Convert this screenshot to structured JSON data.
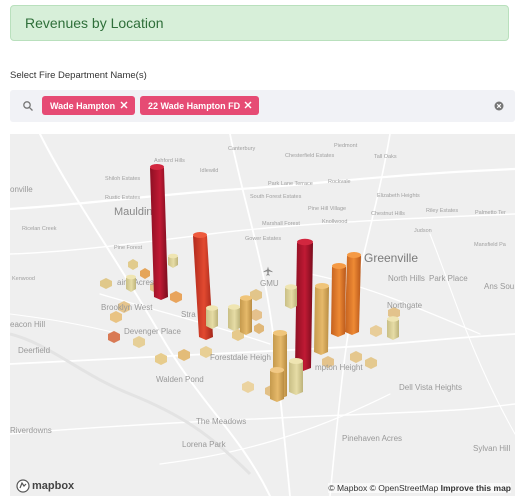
{
  "header": {
    "title": "Revenues by Location"
  },
  "select": {
    "label": "Select Fire Department Name(s)",
    "chips": [
      {
        "label": "Wade Hampton"
      },
      {
        "label": "22 Wade Hampton FD"
      }
    ]
  },
  "map": {
    "labels": {
      "greenville": "Greenville",
      "mauldin": "Mauldin",
      "gmu": "GMU",
      "forestdale": "Forestdale Heigh",
      "hampton_heights": "mpton Height",
      "walden_pond": "Walden Pond",
      "the_meadows": "The Meadows",
      "lorena_park": "Lorena Park",
      "pinehaven_acres": "Pinehaven Acres",
      "dell_vista": "Dell Vista Heights",
      "sylvan_hill": "Sylvan Hill",
      "riverdowns": "Riverdowns",
      "deerfield": "Deerfield",
      "acon_hill": "eacon Hill",
      "kenwood": "Kenwood",
      "brooklyn_west": "Brooklyn West",
      "devenger_place": "Devenger Place",
      "ains_acres": "ains Acres",
      "pine_forest": "Pine Forest",
      "ricelan_creek": "Ricelan Creek",
      "onville": "onville",
      "rustic_estates": "Rustic Estates",
      "shiloh_estates": "Shiloh Estates",
      "ashford_hills": "Ashford Hills",
      "idlewild": "Idlewild",
      "canterbury": "Canterbury",
      "chesterfield": "Chesterfield Estates",
      "piedmont": "Piedmont",
      "tall_oaks": "Tall Oaks",
      "park_lane": "Park Lane Terrace",
      "rockvale": "Rockvale",
      "south_forest": "South Forest Estates",
      "elizabeth_heights": "Elizabeth Heights",
      "pine_hill": "Pine Hill Village",
      "chestnut_hills": "Chestnut Hills",
      "riley_estates": "Riley Estates",
      "palmetto_ter": "Palmetto Ter",
      "marshall_forest": "Marshall Forest",
      "knollwood": "Knollwood",
      "gower_estates": "Gower Estates",
      "judson": "Judson",
      "mansfield": "Mansfield Pa",
      "north_hills": "North Hills",
      "park_place": "Park Place",
      "northgate": "Northgate",
      "stra": "Stra",
      "ans_sou": "Ans Sou"
    }
  },
  "attribution": {
    "mapbox": "© Mapbox",
    "osm": "© OpenStreetMap",
    "improve": "Improve this map",
    "logo_text": "mapbox"
  },
  "icons": {
    "search": "search-icon",
    "chip_remove": "close-icon",
    "clear": "clear-icon",
    "airport": "airport-icon",
    "mapbox_logo": "mapbox-logo-icon"
  },
  "colors": {
    "banner_bg": "#d7efd9",
    "banner_text": "#2f6f3a",
    "chip_bg": "#e64b74",
    "map_bg": "#efefef",
    "bar_dark_red": "#b5132d",
    "bar_red": "#d93a2a",
    "bar_orange": "#e2782a",
    "bar_tan": "#d8b060",
    "bar_light": "#dcd39a"
  }
}
